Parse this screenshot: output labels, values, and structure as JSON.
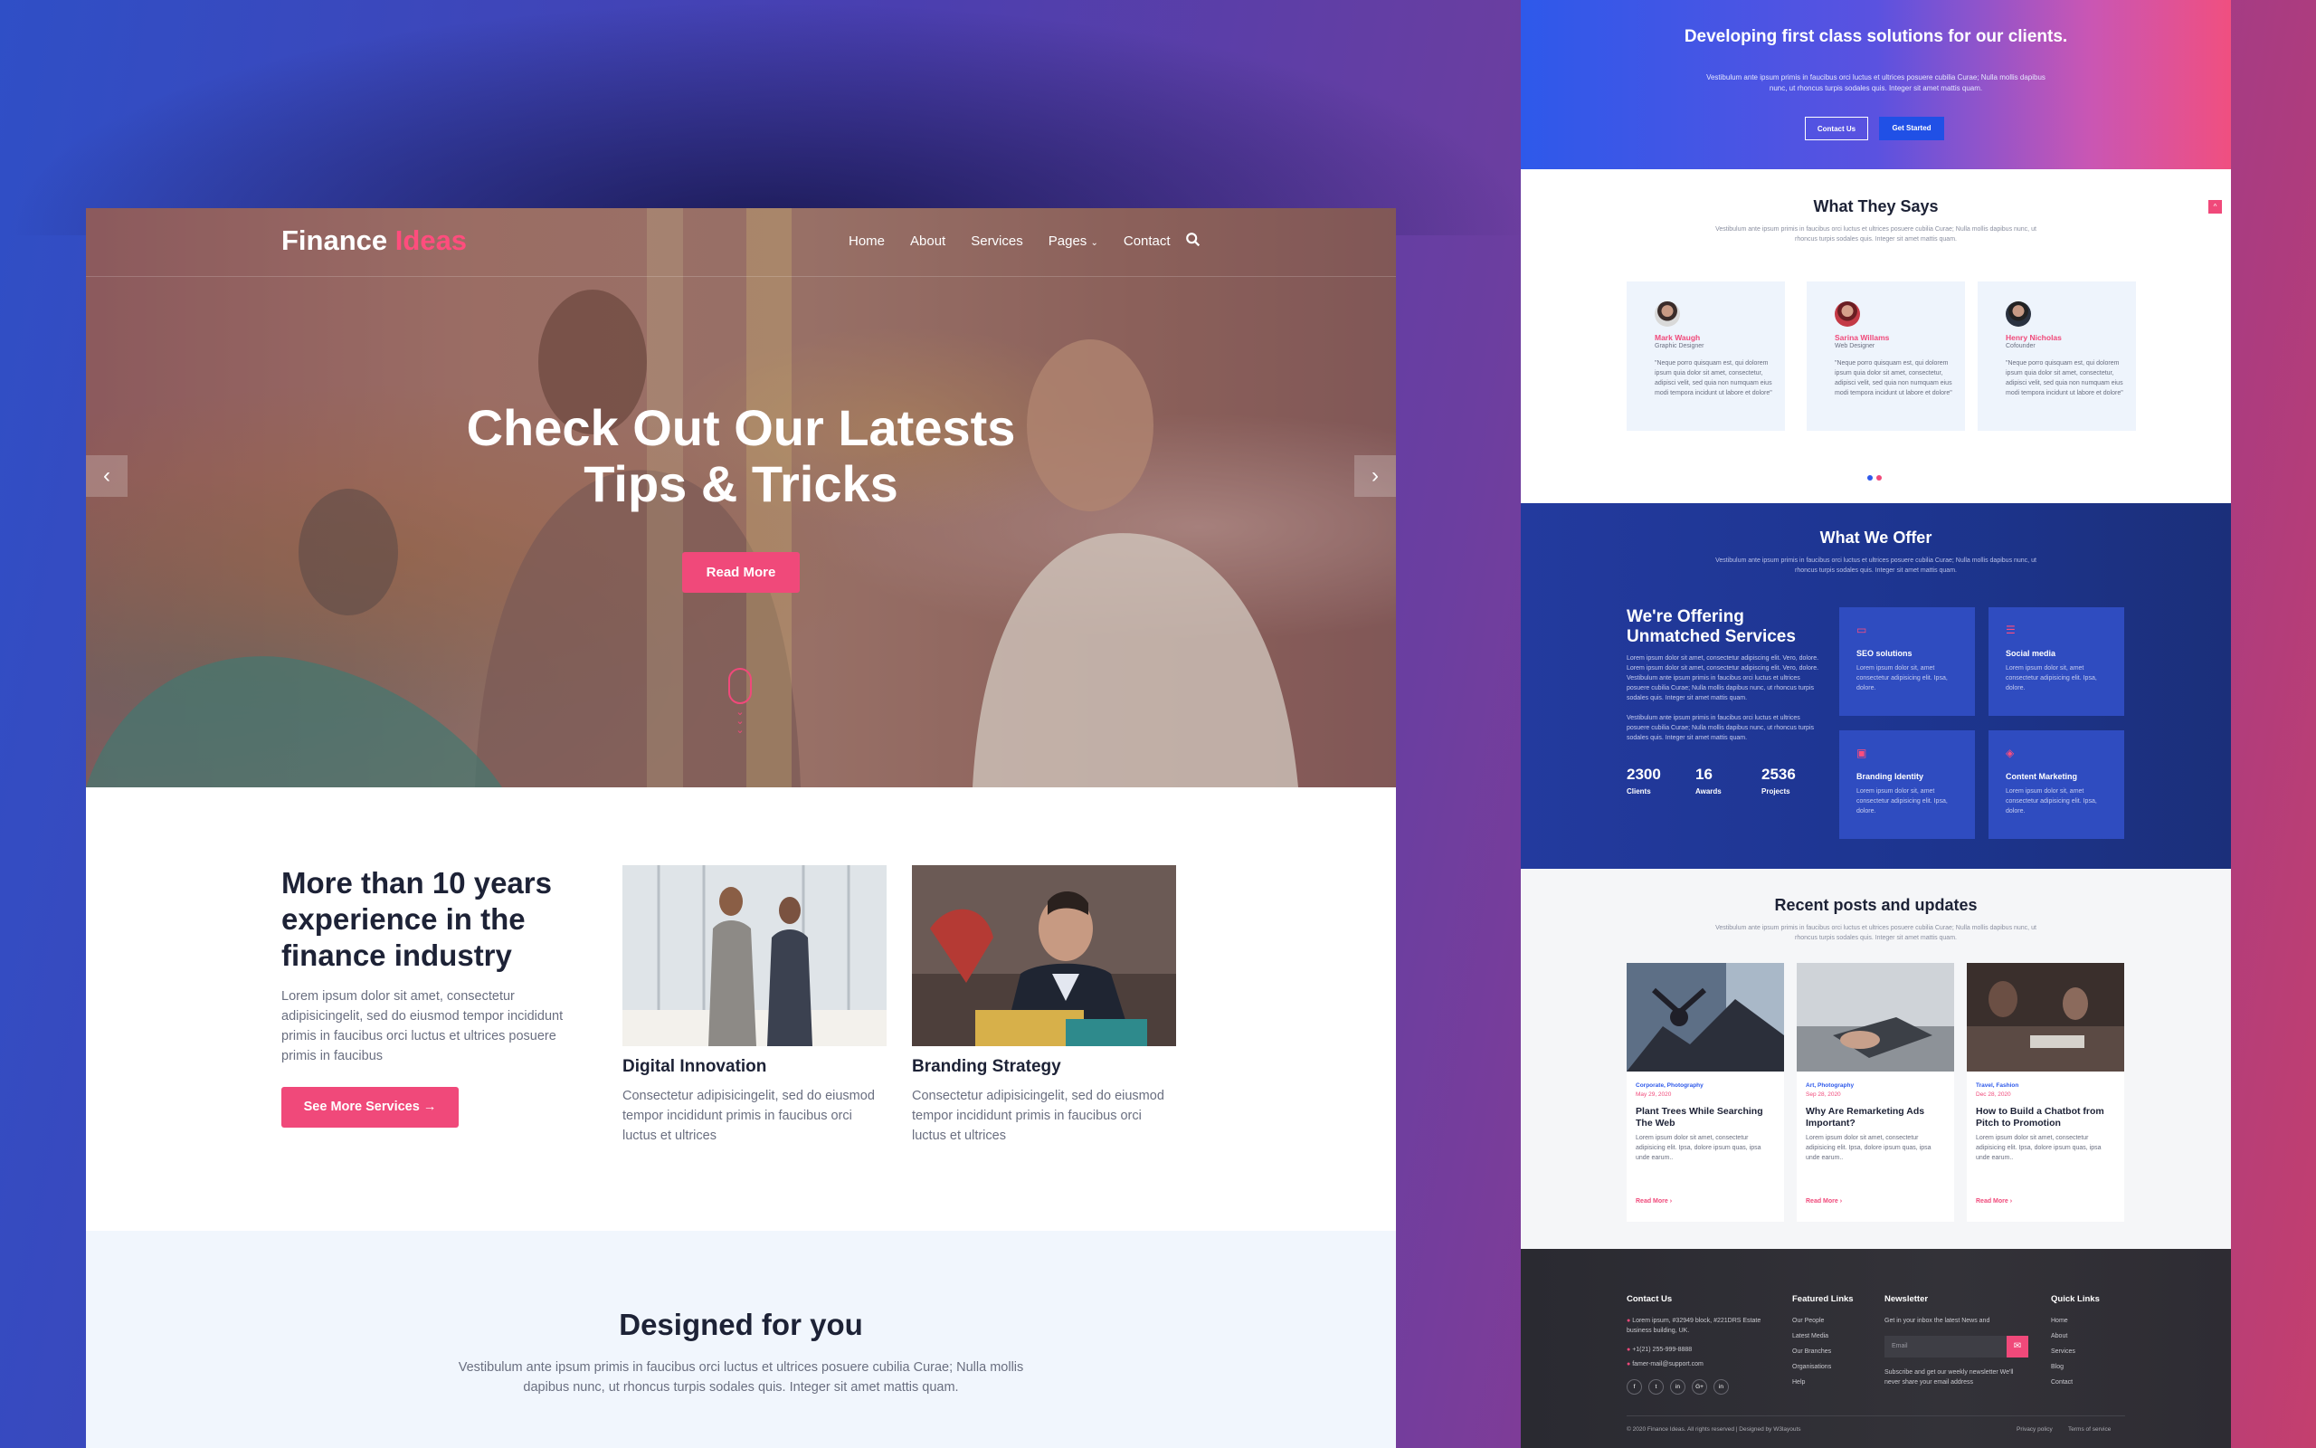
{
  "left": {
    "logo_main": "Finance",
    "logo_accent": "Ideas",
    "nav": [
      "Home",
      "About",
      "Services",
      "Pages",
      "Contact"
    ],
    "hero_title_line1": "Check Out Our Latests",
    "hero_title_line2": "Tips & Tricks",
    "hero_button": "Read More",
    "about_title": "More than 10 years experience in the finance industry",
    "about_text": "Lorem ipsum dolor sit amet, consectetur adipisicingelit, sed do eiusmod tempor incididunt primis in faucibus orci luctus et ultrices posuere primis in faucibus",
    "about_button": "See More Services →",
    "services": [
      {
        "title": "Digital Innovation",
        "text": "Consectetur adipisicingelit, sed do eiusmod tempor incididunt primis in faucibus orci luctus et ultrices"
      },
      {
        "title": "Branding Strategy",
        "text": "Consectetur adipisicingelit, sed do eiusmod tempor incididunt primis in faucibus orci luctus et ultrices"
      }
    ],
    "designed_title": "Designed for you",
    "designed_text": "Vestibulum ante ipsum primis in faucibus orci luctus et ultrices posuere cubilia Curae; Nulla mollis dapibus nunc, ut rhoncus turpis sodales quis. Integer sit amet mattis quam."
  },
  "right": {
    "hero_title": "Developing first class solutions for our clients.",
    "hero_text": "Vestibulum ante ipsum primis in faucibus orci luctus et ultrices posuere cubilia Curae; Nulla mollis dapibus nunc, ut rhoncus turpis sodales quis. Integer sit amet mattis quam.",
    "btn_contact": "Contact Us",
    "btn_start": "Get Started",
    "testimonials_title": "What They Says",
    "section_sub": "Vestibulum ante ipsum primis in faucibus orci luctus et ultrices posuere cubilia Curae; Nulla mollis dapibus nunc, ut rhoncus turpis sodales quis. Integer sit amet mattis quam.",
    "testimonials": [
      {
        "name": "Mark Waugh",
        "role": "Graphic Designer",
        "quote": "\"Neque porro quisquam est, qui dolorem ipsum quia dolor sit amet, consectetur, adipisci velit, sed quia non numquam eius modi tempora incidunt ut labore et dolore\""
      },
      {
        "name": "Sarina Willams",
        "role": "Web Designer",
        "quote": "\"Neque porro quisquam est, qui dolorem ipsum quia dolor sit amet, consectetur, adipisci velit, sed quia non numquam eius modi tempora incidunt ut labore et dolore\""
      },
      {
        "name": "Henry Nicholas",
        "role": "Cofounder",
        "quote": "\"Neque porro quisquam est, qui dolorem ipsum quia dolor sit amet, consectetur, adipisci velit, sed quia non numquam eius modi tempora incidunt ut labore et dolore\""
      }
    ],
    "offer_title": "What We Offer",
    "offer_heading": "We're Offering Unmatched Services",
    "offer_p1": "Lorem ipsum dolor sit amet, consectetur adipiscing elit. Vero, dolore. Lorem ipsum dolor sit amet, consectetur adipiscing elit. Vero, dolore. Vestibulum ante ipsum primis in faucibus orci luctus et ultrices posuere cubilia Curae; Nulla mollis dapibus nunc, ut rhoncus turpis sodales quis. Integer sit amet mattis quam.",
    "offer_p2": "Vestibulum ante ipsum primis in faucibus orci luctus et ultrices posuere cubilia Curae; Nulla mollis dapibus nunc, ut rhoncus turpis sodales quis. Integer sit amet mattis quam.",
    "stats": [
      {
        "n": "2300",
        "l": "Clients"
      },
      {
        "n": "16",
        "l": "Awards"
      },
      {
        "n": "2536",
        "l": "Projects"
      }
    ],
    "offers": [
      {
        "icon": "laptop-icon",
        "title": "SEO solutions",
        "desc": "Lorem ipsum dolor sit, amet consectetur adipisicing elit. Ipsa, dolore."
      },
      {
        "icon": "database-icon",
        "title": "Social media",
        "desc": "Lorem ipsum dolor sit, amet consectetur adipisicing elit. Ipsa, dolore."
      },
      {
        "icon": "lock-icon",
        "title": "Branding Identity",
        "desc": "Lorem ipsum dolor sit, amet consectetur adipisicing elit. Ipsa, dolore."
      },
      {
        "icon": "cube-icon",
        "title": "Content Marketing",
        "desc": "Lorem ipsum dolor sit, amet consectetur adipisicing elit. Ipsa, dolore."
      }
    ],
    "posts_title": "Recent posts and updates",
    "posts": [
      {
        "cat": "Corporate, Photography",
        "date": "May 29, 2020",
        "title": "Plant Trees While Searching The Web",
        "desc": "Lorem ipsum dolor sit amet, consectetur adipisicing elit. Ipsa, dolore ipsum quas, ipsa unde earum..",
        "more": "Read More ›"
      },
      {
        "cat": "Art, Photography",
        "date": "Sep 28, 2020",
        "title": "Why Are Remarketing Ads Important?",
        "desc": "Lorem ipsum dolor sit amet, consectetur adipisicing elit. Ipsa, dolore ipsum quas, ipsa unde earum..",
        "more": "Read More ›"
      },
      {
        "cat": "Travel, Fashion",
        "date": "Dec 28, 2020",
        "title": "How to Build a Chatbot from Pitch to Promotion",
        "desc": "Lorem ipsum dolor sit amet, consectetur adipisicing elit. Ipsa, dolore ipsum quas, ipsa unde earum..",
        "more": "Read More ›"
      }
    ],
    "footer": {
      "contact_h": "Contact Us",
      "address": "Lorem ipsum, #32949 block, #221DRS Estate business building, UK.",
      "phone": "+1(21) 255-999-8888",
      "email": "famer-mail@support.com",
      "featured_h": "Featured Links",
      "featured": [
        "Our People",
        "Latest Media",
        "Our Branches",
        "Organisations",
        "Help"
      ],
      "news_h": "Newsletter",
      "news_text": "Get in your inbox the latest News and",
      "email_ph": "Email",
      "news_note": "Subscribe and get our weekly newsletter We'll never share your email address",
      "quick_h": "Quick Links",
      "quick": [
        "Home",
        "About",
        "Services",
        "Blog",
        "Contact"
      ],
      "social": [
        "f",
        "t",
        "in",
        "G+",
        "in"
      ],
      "copyright": "© 2020 Finance Ideas. All rights reserved | Designed by W3layouts",
      "privacy": "Privacy policy",
      "terms": "Terms of service"
    }
  }
}
